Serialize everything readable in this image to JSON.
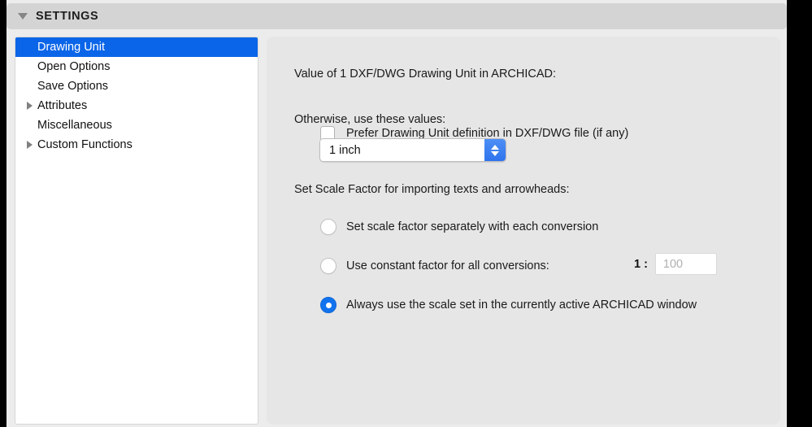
{
  "header": {
    "title": "SETTINGS",
    "disclosure_icon": "triangle-down-icon"
  },
  "sidebar": {
    "items": [
      {
        "label": "Drawing Unit",
        "selected": true,
        "expandable": false
      },
      {
        "label": "Open Options",
        "selected": false,
        "expandable": false
      },
      {
        "label": "Save Options",
        "selected": false,
        "expandable": false
      },
      {
        "label": "Attributes",
        "selected": false,
        "expandable": true
      },
      {
        "label": "Miscellaneous",
        "selected": false,
        "expandable": false
      },
      {
        "label": "Custom Functions",
        "selected": false,
        "expandable": true
      }
    ]
  },
  "content": {
    "drawing_unit_heading": "Value of 1 DXF/DWG Drawing Unit in ARCHICAD:",
    "prefer_checkbox_label": "Prefer Drawing Unit definition in DXF/DWG file (if any)",
    "prefer_checkbox_checked": false,
    "otherwise_label": "Otherwise, use these values:",
    "unit_select_value": "1 inch",
    "unit_select_options": [
      "1 inch"
    ],
    "scale_factor_heading": "Set Scale Factor for importing texts and arrowheads:",
    "radios": [
      {
        "label": "Set scale factor separately with each conversion",
        "selected": false
      },
      {
        "label": "Use constant factor for all conversions:",
        "selected": false
      },
      {
        "label": "Always use the scale set in the currently active ARCHICAD window",
        "selected": true
      }
    ],
    "ratio_prefix": "1 :",
    "ratio_value": "100",
    "ratio_placeholder": "100"
  },
  "colors": {
    "selection_blue": "#0a65e8",
    "radio_blue": "#1273ef",
    "stepper_blue": "#2f74ee",
    "header_bar": "#d4d4d4",
    "panel_bg": "#e6e6e6",
    "sidebar_bg": "#ffffff"
  }
}
